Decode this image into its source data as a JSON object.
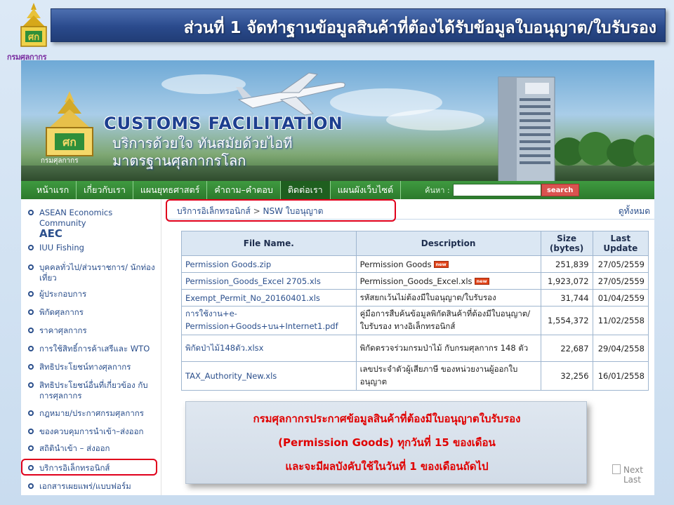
{
  "slide": {
    "logo_text": "กรมศุลกากร",
    "title": "ส่วนที่ 1 จัดทำฐานข้อมูลสินค้าที่ต้องได้รับข้อมูลใบอนุญาต/ใบรับรอง"
  },
  "banner": {
    "title": "CUSTOMS FACILITATION",
    "line1": "บริการด้วยใจ ทันสมัยด้วยไอที",
    "line2": "มาตรฐานศุลกากรโลก",
    "seal_text": "กรมศุลกากร"
  },
  "nav": {
    "items": [
      "หน้าแรก",
      "เกี่ยวกับเรา",
      "แผนยุทธศาสตร์",
      "คำถาม–คำตอบ",
      "ติดต่อเรา",
      "แผนผังเว็บไซต์"
    ],
    "active_index": 4,
    "search_label": "ค้นหา :",
    "search_button": "search"
  },
  "sidebar": {
    "items": [
      {
        "label": "ASEAN Economics Community",
        "sub": "AEC"
      },
      {
        "label": "IUU Fishing"
      },
      {
        "label": "บุคคลทั่วไป/ส่วนราชการ/ นักท่องเที่ยว"
      },
      {
        "label": "ผู้ประกอบการ"
      },
      {
        "label": "พิกัดศุลกากร"
      },
      {
        "label": "ราคาศุลกากร"
      },
      {
        "label": "การใช้สิทธิ์การค้าเสรีและ WTO"
      },
      {
        "label": "สิทธิประโยชน์ทางศุลกากร"
      },
      {
        "label": "สิทธิประโยชน์อื่นที่เกี่ยวข้อง กับการศุลกากร"
      },
      {
        "label": "กฎหมาย/ประกาศกรมศุลกากร"
      },
      {
        "label": "ของควบคุมการนำเข้า–ส่งออก"
      },
      {
        "label": "สถิตินำเข้า – ส่งออก"
      },
      {
        "label": "บริการอิเล็กทรอนิกส์"
      },
      {
        "label": "เอกสารเผยแพร่/แบบฟอร์ม"
      }
    ]
  },
  "breadcrumb": {
    "parent": "บริการอิเล็กทรอนิกส์",
    "separator": ">",
    "current": "NSW ใบอนุญาต"
  },
  "view_all": "ดูทั้งหมด",
  "table": {
    "headers": {
      "file": "File Name.",
      "description": "Description",
      "size": "Size (bytes)",
      "updated": "Last Update"
    },
    "new_badge": "new",
    "rows": [
      {
        "file": "Permission Goods.zip",
        "description": "Permission Goods",
        "is_new": true,
        "size": "251,839",
        "updated": "27/05/2559"
      },
      {
        "file": "Permission_Goods_Excel 2705.xls",
        "description": "Permission_Goods_Excel.xls",
        "is_new": true,
        "size": "1,923,072",
        "updated": "27/05/2559"
      },
      {
        "file": "Exempt_Permit_No_20160401.xls",
        "description": "รหัสยกเว้นไม่ต้องมีใบอนุญาต/ใบรับรอง",
        "is_new": false,
        "size": "31,744",
        "updated": "01/04/2559"
      },
      {
        "file": "การใช้งาน+e-Permission+Goods+บน+Internet1.pdf",
        "description": "คู่มือการสืบค้นข้อมูลพิกัดสินค้าที่ต้องมีใบอนุญาต/ใบรับรอง ทางอิเล็กทรอนิกส์",
        "is_new": false,
        "size": "1,554,372",
        "updated": "11/02/2558"
      },
      {
        "file": "พิกัดป่าไม้148ตัว.xlsx",
        "description": "พิกัดตรวจร่วมกรมป่าไม้ กับกรมศุลกากร 148 ตัว",
        "is_new": false,
        "size": "22,687",
        "updated": "29/04/2558"
      },
      {
        "file": "TAX_Authority_New.xls",
        "description": "เลขประจำตัวผู้เสียภาษี ของหน่วยงานผู้ออกใบอนุญาต",
        "is_new": false,
        "size": "32,256",
        "updated": "16/01/2558"
      }
    ]
  },
  "pager": "Next Last",
  "callout": {
    "line1": "กรมศุลกากรประกาศข้อมูลสินค้าที่ต้องมีใบอนุญาตใบรับรอง",
    "line2": "(Permission Goods) ทุกวันที่ 15 ของเดือน",
    "line3": "และจะมีผลบังคับใช้ในวันที่ 1 ของเดือนถัดไป"
  },
  "colors": {
    "title_bar": "#2a4a8c",
    "nav_green": "#2c7a2c",
    "link_blue": "#2b4f8c",
    "highlight_red": "#e0001b",
    "callout_text": "#e00000"
  }
}
